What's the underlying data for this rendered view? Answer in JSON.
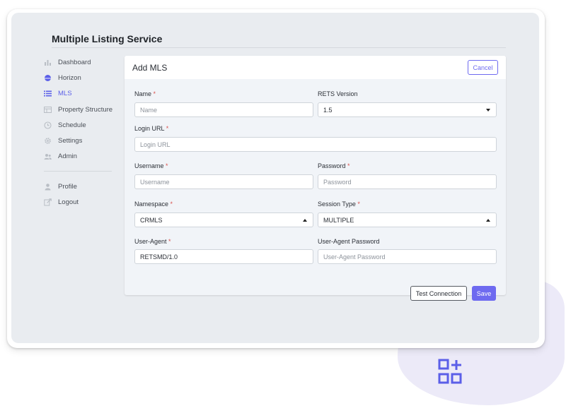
{
  "app": {
    "title": "Multiple Listing Service"
  },
  "sidebar": {
    "items": [
      {
        "label": "Dashboard",
        "icon": "bar-chart-icon"
      },
      {
        "label": "Horizon",
        "icon": "horizon-icon"
      },
      {
        "label": "MLS",
        "icon": "list-icon",
        "active": true
      },
      {
        "label": "Property Structure",
        "icon": "table-icon"
      },
      {
        "label": "Schedule",
        "icon": "clock-icon"
      },
      {
        "label": "Settings",
        "icon": "gear-icon"
      },
      {
        "label": "Admin",
        "icon": "users-icon"
      }
    ],
    "secondary": [
      {
        "label": "Profile",
        "icon": "user-icon"
      },
      {
        "label": "Logout",
        "icon": "logout-icon"
      }
    ]
  },
  "form": {
    "title": "Add MLS",
    "cancel_label": "Cancel",
    "required_mark": "*",
    "name": {
      "label": "Name",
      "placeholder": "Name"
    },
    "rets_version": {
      "label": "RETS Version",
      "value": "1.5"
    },
    "login_url": {
      "label": "Login URL",
      "placeholder": "Login URL"
    },
    "username": {
      "label": "Username",
      "placeholder": "Username"
    },
    "password": {
      "label": "Password",
      "placeholder": "Password"
    },
    "namespace": {
      "label": "Namespace",
      "value": "CRMLS"
    },
    "session_type": {
      "label": "Session Type",
      "value": "MULTIPLE"
    },
    "user_agent": {
      "label": "User-Agent",
      "value": "RETSMD/1.0"
    },
    "user_agent_password": {
      "label": "User-Agent Password",
      "placeholder": "User-Agent Password"
    },
    "test_label": "Test Connection",
    "save_label": "Save"
  },
  "colors": {
    "accent": "#6e6af0",
    "active_nav": "#5b5fe8",
    "required": "#d9534f",
    "panel": "#e9ecf0"
  }
}
